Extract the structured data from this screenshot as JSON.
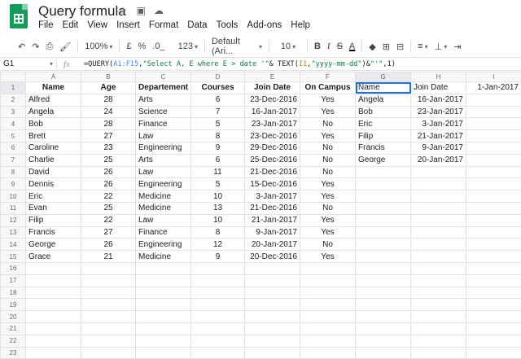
{
  "app": {
    "title": "Query formula",
    "menus": [
      "File",
      "Edit",
      "View",
      "Insert",
      "Format",
      "Data",
      "Tools",
      "Add-ons",
      "Help"
    ]
  },
  "toolbar": {
    "zoom": "100%",
    "currency": "£",
    "percent": "%",
    "dec_less": ".0_",
    ".00": ".00",
    "more_formats": "123",
    "font": "Default (Ari...",
    "font_size": "10",
    "bold": "B",
    "italic": "I",
    "strike": "S",
    "text_color": "A"
  },
  "formula_bar": {
    "cell_ref": "G1",
    "fx": "fx",
    "formula_parts": [
      {
        "t": "=QUERY(",
        "c": ""
      },
      {
        "t": "A1:F15",
        "c": "range"
      },
      {
        "t": ",",
        "c": ""
      },
      {
        "t": "\"Select A, E where E > date '\"",
        "c": "str"
      },
      {
        "t": "& TEXT(",
        "c": ""
      },
      {
        "t": "I1",
        "c": "cell"
      },
      {
        "t": ",",
        "c": ""
      },
      {
        "t": "\"yyyy-mm-dd\"",
        "c": "str"
      },
      {
        "t": ")&",
        "c": ""
      },
      {
        "t": "\"'\"",
        "c": "str"
      },
      {
        "t": ",1)",
        "c": ""
      }
    ]
  },
  "columns": [
    "A",
    "B",
    "C",
    "D",
    "E",
    "F",
    "G",
    "H",
    "I"
  ],
  "rows": [
    [
      "Name",
      "Age",
      "Departement",
      "Courses",
      "Join Date",
      "On Campus",
      "Name",
      "Join Date",
      "1-Jan-2017"
    ],
    [
      "Alfred",
      "28",
      "Arts",
      "6",
      "23-Dec-2016",
      "Yes",
      "Angela",
      "16-Jan-2017",
      ""
    ],
    [
      "Angela",
      "24",
      "Science",
      "7",
      "16-Jan-2017",
      "Yes",
      "Bob",
      "23-Jan-2017",
      ""
    ],
    [
      "Bob",
      "28",
      "Finance",
      "5",
      "23-Jan-2017",
      "No",
      "Eric",
      "3-Jan-2017",
      ""
    ],
    [
      "Brett",
      "27",
      "Law",
      "8",
      "23-Dec-2016",
      "Yes",
      "Filip",
      "21-Jan-2017",
      ""
    ],
    [
      "Caroline",
      "23",
      "Engineering",
      "9",
      "29-Dec-2016",
      "No",
      "Francis",
      "9-Jan-2017",
      ""
    ],
    [
      "Charlie",
      "25",
      "Arts",
      "6",
      "25-Dec-2016",
      "No",
      "George",
      "20-Jan-2017",
      ""
    ],
    [
      "David",
      "26",
      "Law",
      "11",
      "21-Dec-2016",
      "No",
      "",
      "",
      ""
    ],
    [
      "Dennis",
      "26",
      "Engineering",
      "5",
      "15-Dec-2016",
      "Yes",
      "",
      "",
      ""
    ],
    [
      "Eric",
      "22",
      "Medicine",
      "10",
      "3-Jan-2017",
      "Yes",
      "",
      "",
      ""
    ],
    [
      "Evan",
      "25",
      "Medicine",
      "13",
      "21-Dec-2016",
      "No",
      "",
      "",
      ""
    ],
    [
      "Filip",
      "22",
      "Law",
      "10",
      "21-Jan-2017",
      "Yes",
      "",
      "",
      ""
    ],
    [
      "Francis",
      "27",
      "Finance",
      "8",
      "9-Jan-2017",
      "Yes",
      "",
      "",
      ""
    ],
    [
      "George",
      "26",
      "Engineering",
      "12",
      "20-Jan-2017",
      "No",
      "",
      "",
      ""
    ],
    [
      "Grace",
      "21",
      "Medicine",
      "9",
      "20-Dec-2016",
      "Yes",
      "",
      "",
      ""
    ],
    [
      "",
      "",
      "",
      "",
      "",
      "",
      "",
      "",
      ""
    ],
    [
      "",
      "",
      "",
      "",
      "",
      "",
      "",
      "",
      ""
    ],
    [
      "",
      "",
      "",
      "",
      "",
      "",
      "",
      "",
      ""
    ],
    [
      "",
      "",
      "",
      "",
      "",
      "",
      "",
      "",
      ""
    ],
    [
      "",
      "",
      "",
      "",
      "",
      "",
      "",
      "",
      ""
    ],
    [
      "",
      "",
      "",
      "",
      "",
      "",
      "",
      "",
      ""
    ],
    [
      "",
      "",
      "",
      "",
      "",
      "",
      "",
      "",
      ""
    ],
    [
      "",
      "",
      "",
      "",
      "",
      "",
      "",
      "",
      ""
    ]
  ]
}
